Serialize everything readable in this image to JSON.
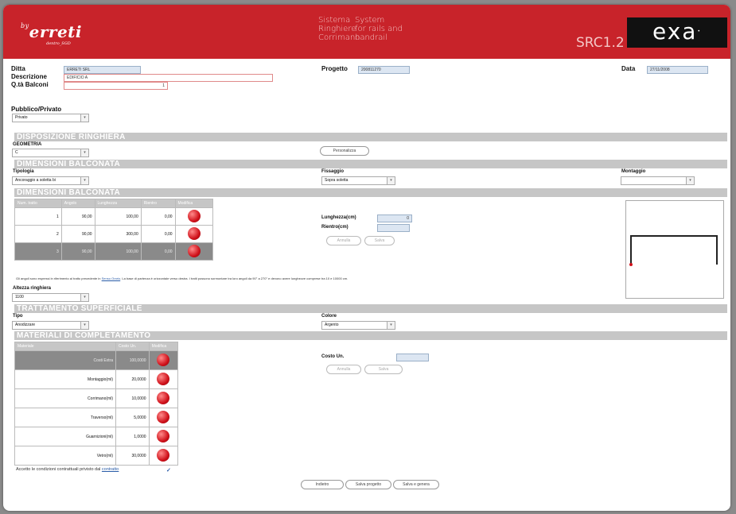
{
  "header": {
    "logo_by": "by",
    "logo": "erreti",
    "logo_sub": "dentro_SGD",
    "tag_it": [
      "Sistema",
      "Ringhiere",
      "Corrimano"
    ],
    "tag_en": [
      "System",
      "for rails and",
      "handrail"
    ],
    "code": "SRC1.2",
    "brand": "exa",
    "colors": {
      "header_bg": "#c8232a",
      "brand_bg": "#111111"
    }
  },
  "form": {
    "ditta_label": "Ditta",
    "ditta_value": "ERRETI SRL",
    "descrizione_label": "Descrizione",
    "descrizione_value": "EDIFICIO A",
    "balconi_label": "Q.tà Balconi",
    "balconi_value": "1",
    "progetto_label": "Progetto",
    "progetto_value": "200811270",
    "data_label": "Data",
    "data_value": "27/11/2008",
    "pubblico_label": "Pubblico/Privato",
    "pubblico_value": "Privato"
  },
  "disposizione": {
    "title": "DISPOSIZIONE RINGHIERA",
    "geometria_label": "GEOMETRIA",
    "geometria_value": "C",
    "personalizza": "Personalizza"
  },
  "dimensioni1": {
    "title": "DIMENSIONI BALCONATA",
    "tipologia_label": "Tipologia",
    "tipologia_value": "Ancoraggio a soletta bi",
    "fissaggio_label": "Fissaggio",
    "fissaggio_value": "Sopra soletta",
    "montaggio_label": "Montaggio",
    "montaggio_value": ""
  },
  "dimensioni2": {
    "title": "DIMENSIONI BALCONATA",
    "headers": [
      "Num. tratto",
      "Angolo",
      "Lunghezza",
      "Rientro",
      "Modifica"
    ],
    "rows": [
      {
        "num": "1",
        "angolo": "90,00",
        "lunghezza": "100,00",
        "rientro": "0,00"
      },
      {
        "num": "2",
        "angolo": "90,00",
        "lunghezza": "300,00",
        "rientro": "0,00"
      },
      {
        "num": "3",
        "angolo": "90,00",
        "lunghezza": "100,00",
        "rientro": "0,00"
      }
    ],
    "lunghezza_label": "Lunghezza(cm)",
    "lunghezza_value": "0",
    "rientro_label": "Rientro(cm)",
    "rientro_value": "",
    "annulla": "Annulla",
    "salva": "Salva",
    "note_pre": "Gli angoli sono espressi in riferimento al tratto precedente in",
    "note_link": "Senso Orario",
    "note_post": ". La base di partenza è orizzontale verso destra. I tratti possono sormontare tra loro angoli da 90° a 270° e devono avere lunghezze comprese tra 10 e 10000 cm.",
    "altezza_label": "Altezza ringhiera",
    "altezza_value": "1100"
  },
  "trattamento": {
    "title": "TRATTAMENTO SUPERFICIALE",
    "tipo_label": "Tipo",
    "tipo_value": "Anodizzare",
    "colore_label": "Colore",
    "colore_value": "Argento"
  },
  "materiali": {
    "title": "MATERIALI DI COMPLETAMENTO",
    "headers": [
      "Materiale",
      "Costo Un.",
      "Modifica"
    ],
    "rows": [
      {
        "name": "Costi Extra",
        "costo": "100,0000"
      },
      {
        "name": "Montaggio(ml)",
        "costo": "20,0000"
      },
      {
        "name": "Corrimano(ml)",
        "costo": "10,0000"
      },
      {
        "name": "Traverso(ml)",
        "costo": "5,0000"
      },
      {
        "name": "Guarnizioni(ml)",
        "costo": "1,0000"
      },
      {
        "name": "Vetro(ml)",
        "costo": "30,0000"
      }
    ],
    "costo_label": "Costo Un.",
    "costo_value": "",
    "annulla": "Annulla",
    "salva": "Salva"
  },
  "footer": {
    "accetto_text": "Accetto le condizioni contrattuali privisto dal",
    "accetto_link": "contratto",
    "check": "✓",
    "indietro": "Indietro",
    "salva_progetto": "Salva progetto",
    "salva_genera": "Salva e genera"
  }
}
